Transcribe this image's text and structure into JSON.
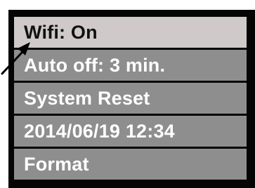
{
  "menu": {
    "items": [
      {
        "label": "Wifi: On",
        "selected": true
      },
      {
        "label": "Auto off: 3 min.",
        "selected": false
      },
      {
        "label": "System Reset",
        "selected": false
      },
      {
        "label": "2014/06/19 12:34",
        "selected": false
      },
      {
        "label": "Format",
        "selected": false
      }
    ]
  },
  "colors": {
    "frame": "#050505",
    "item_background": "#8e8e8e",
    "selected_background": "#cfc9c9",
    "item_text": "#ffffff",
    "selected_text": "#111111"
  },
  "icons": {
    "pointer": "arrow-pointer-icon"
  }
}
